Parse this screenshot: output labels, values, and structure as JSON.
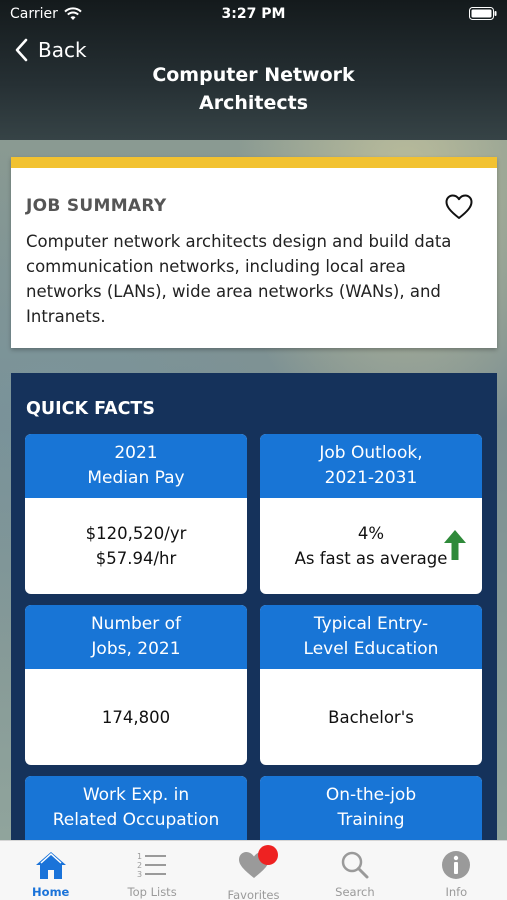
{
  "status_bar": {
    "carrier": "Carrier",
    "time": "3:27 PM"
  },
  "nav": {
    "back_label": "Back",
    "title": "Computer Network Architects"
  },
  "summary": {
    "heading": "JOB SUMMARY",
    "text": "Computer network architects design and build data communication networks, including local area networks (LANs), wide area networks (WANs), and Intranets."
  },
  "quick_facts": {
    "heading": "QUICK FACTS",
    "items": [
      {
        "label": "2021\nMedian Pay",
        "value": "$120,520/yr\n$57.94/hr"
      },
      {
        "label": "Job Outlook,\n2021-2031",
        "value": "4%\nAs fast as average"
      },
      {
        "label": "Number of\nJobs, 2021",
        "value": "174,800"
      },
      {
        "label": "Typical Entry-\nLevel Education",
        "value": "Bachelor's"
      },
      {
        "label": "Work Exp. in\nRelated Occupation",
        "value": ""
      },
      {
        "label": "On-the-job\nTraining",
        "value": ""
      }
    ]
  },
  "tabs": [
    {
      "label": "Home",
      "icon": "home-icon"
    },
    {
      "label": "Top Lists",
      "icon": "list-icon"
    },
    {
      "label": "Favorites",
      "icon": "heart-icon"
    },
    {
      "label": "Search",
      "icon": "search-icon"
    },
    {
      "label": "Info",
      "icon": "info-icon"
    }
  ],
  "colors": {
    "accent": "#1a73d9",
    "card_header": "#1875d6",
    "quick_facts_bg": "#15325b",
    "summary_border": "#f2c231",
    "up_arrow": "#2f8a3a",
    "badge": "#ee2222"
  }
}
